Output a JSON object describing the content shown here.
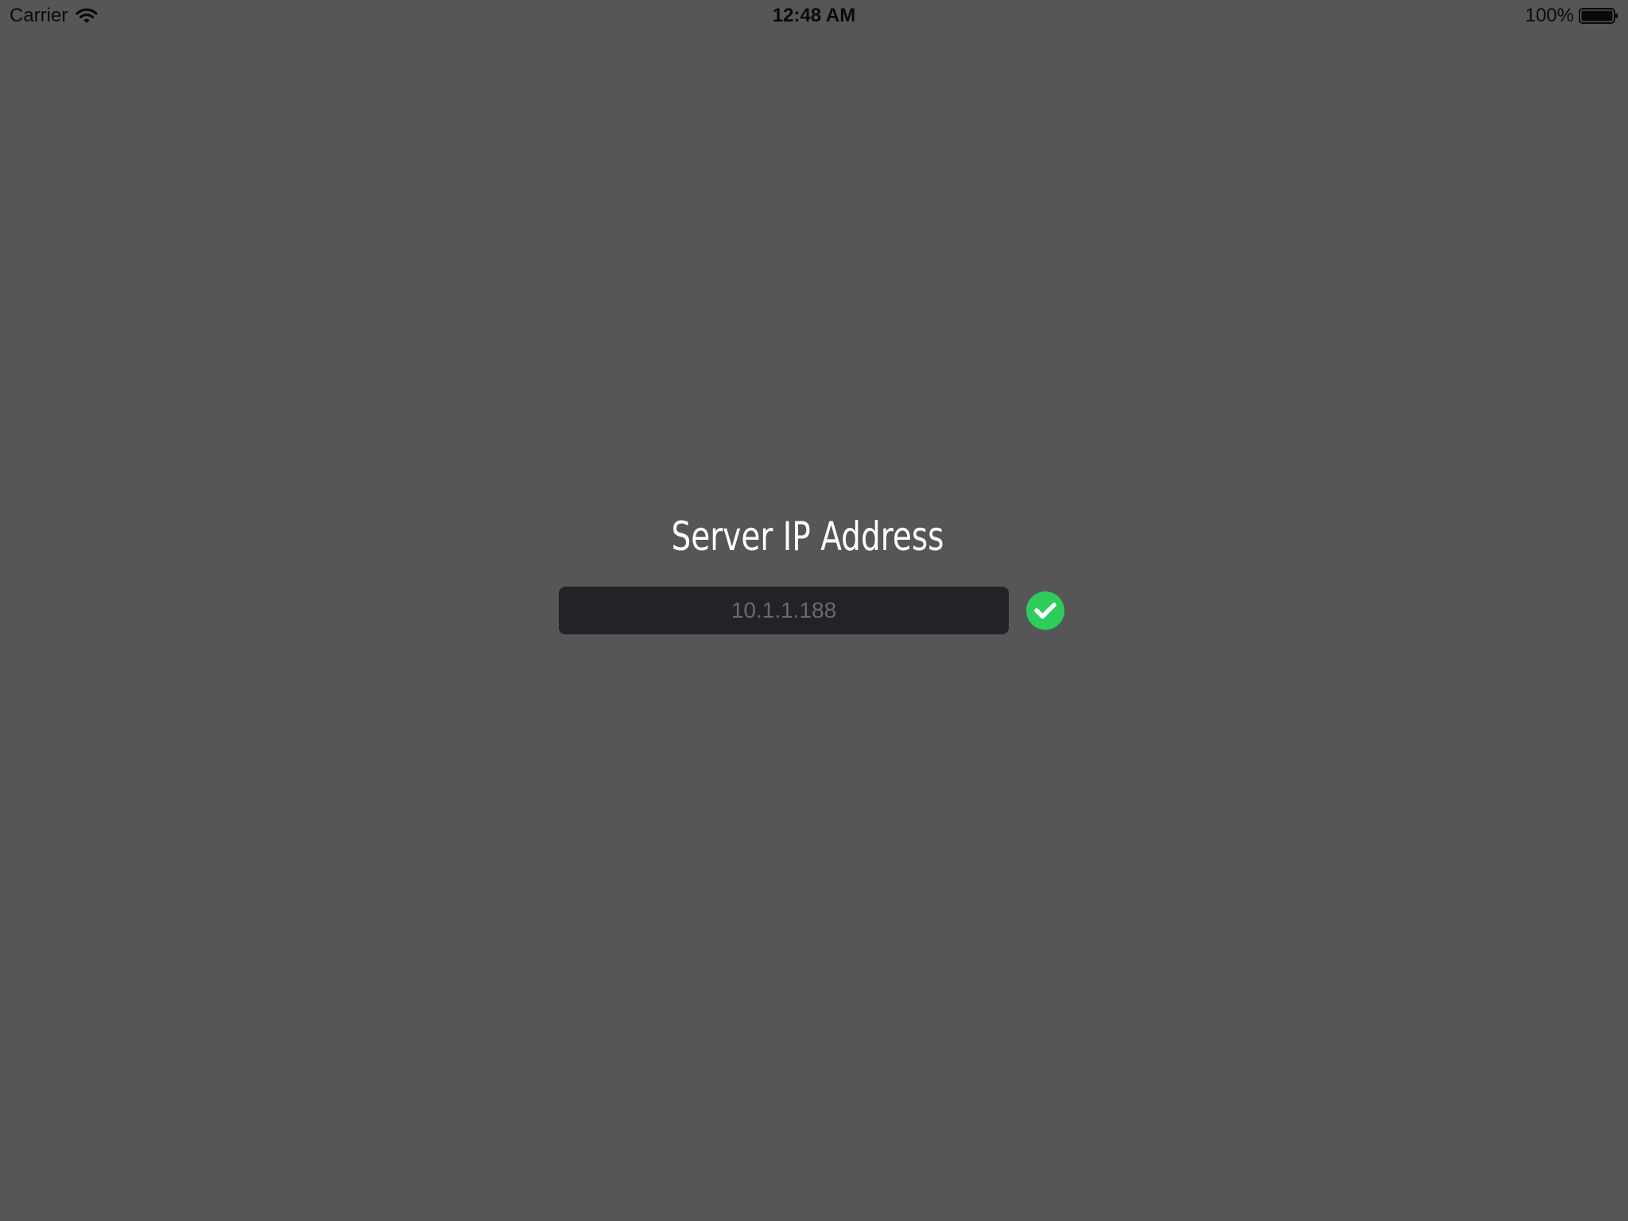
{
  "status_bar": {
    "carrier": "Carrier",
    "time": "12:48 AM",
    "battery_percent": "100%",
    "battery_level": 1.0,
    "wifi_icon": "wifi-icon",
    "battery_icon": "battery-icon"
  },
  "main": {
    "title": "Server IP Address",
    "ip_input": {
      "value": "",
      "placeholder": "10.1.1.188"
    },
    "confirm_icon": "checkmark-circle-icon"
  },
  "colors": {
    "background": "#565656",
    "field_background": "#222326",
    "placeholder_text": "#6a6a6e",
    "accent_green": "#2ecc5a",
    "title_text": "#ffffff"
  }
}
